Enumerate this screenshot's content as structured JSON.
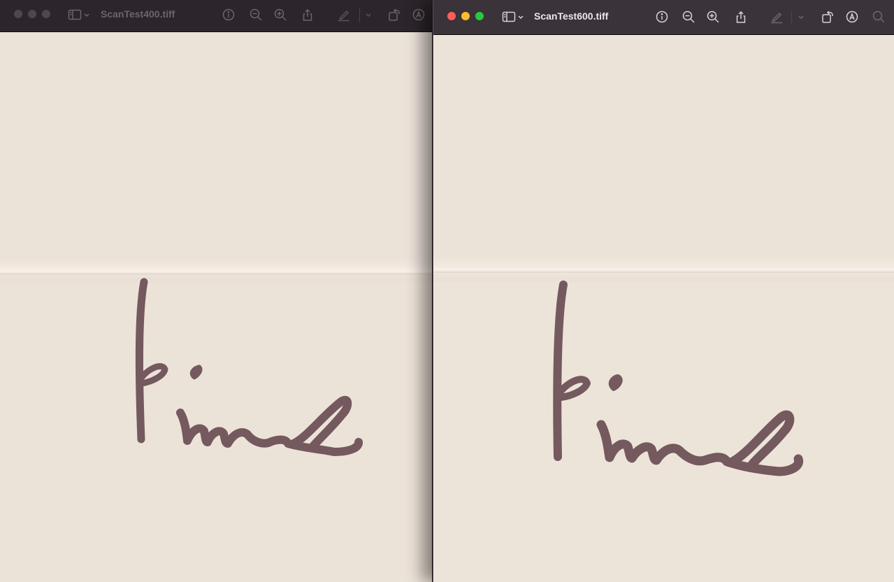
{
  "left_window": {
    "title": "ScanTest400.tiff",
    "state": "inactive",
    "toolbar": [
      "sidebar-toggle-icon",
      "chevron-down-icon",
      "info-icon",
      "zoom-out-icon",
      "zoom-in-icon",
      "share-icon",
      "markup-pen-icon",
      "chevron-down-icon",
      "rotate-icon",
      "markup-icon"
    ]
  },
  "right_window": {
    "title": "ScanTest600.tiff",
    "state": "active",
    "toolbar": [
      "sidebar-toggle-icon",
      "chevron-down-icon",
      "info-icon",
      "zoom-out-icon",
      "zoom-in-icon",
      "share-icon",
      "markup-pen-icon",
      "chevron-down-icon",
      "rotate-icon",
      "markup-icon",
      "search-icon"
    ]
  },
  "colors": {
    "titlebar_inactive": "#2d252c",
    "titlebar_active": "#3a3339",
    "paper": "#ece3d8",
    "ink": "#6b4f55",
    "close": "#fe5f57",
    "minimize": "#febc2e",
    "zoom": "#28c840"
  },
  "content": {
    "description_icon": "handwritten-word-image"
  }
}
